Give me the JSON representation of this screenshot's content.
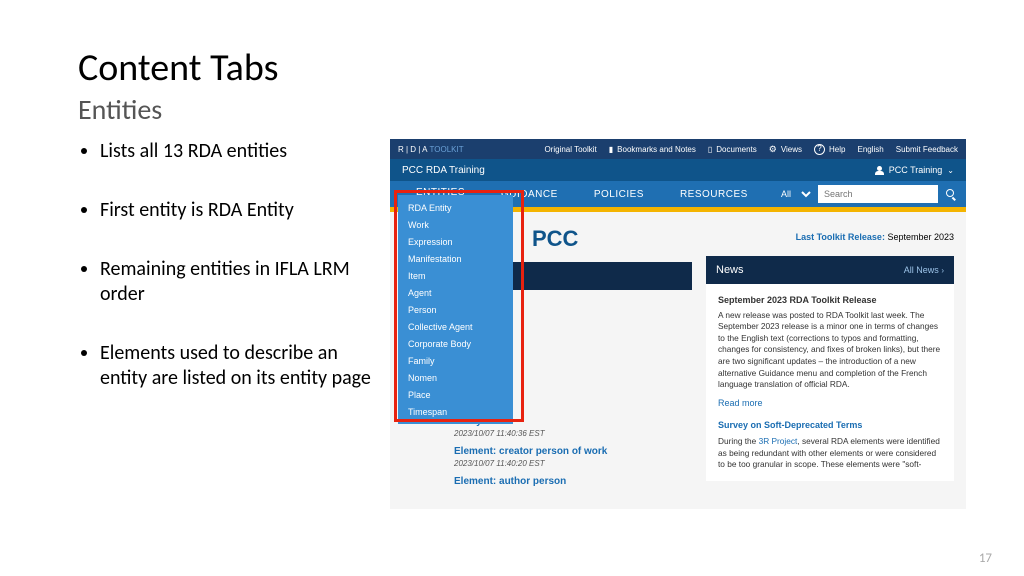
{
  "slide": {
    "title": "Content Tabs",
    "subtitle": "Entities",
    "bullets": [
      "Lists all 13 RDA entities",
      "First entity is RDA Entity",
      "Remaining entities in IFLA LRM order",
      "Elements used to describe an entity are listed on its entity page"
    ],
    "page_number": "17"
  },
  "screenshot": {
    "brand_prefix": "R | D | A",
    "brand_suffix": "TOOLKIT",
    "top_links": {
      "original": "Original Toolkit",
      "bookmarks": "Bookmarks and Notes",
      "documents": "Documents",
      "views": "Views",
      "help": "Help",
      "lang": "English",
      "feedback": "Submit Feedback"
    },
    "header2_title": "PCC RDA Training",
    "user_label": "PCC Training",
    "nav": {
      "entities": "ENTITIES",
      "guidance": "GUIDANCE",
      "policies": "POLICIES",
      "resources": "RESOURCES",
      "filter_all": "All",
      "search_placeholder": "Search"
    },
    "dropdown": [
      "RDA Entity",
      "Work",
      "Expression",
      "Manifestation",
      "Item",
      "Agent",
      "Person",
      "Collective Agent",
      "Corporate Body",
      "Family",
      "Nomen",
      "Place",
      "Timespan"
    ],
    "main_title": "PCC",
    "release_label": "Last Toolkit Release:",
    "release_value": "September 2023",
    "recent": [
      {
        "title": "Entity: Work",
        "ts": "2023/10/07 11:40:36 EST"
      },
      {
        "title": "Element: creator person of work",
        "ts": "2023/10/07 11:40:20 EST"
      },
      {
        "title": "Element: author person",
        "ts": ""
      }
    ],
    "news": {
      "heading": "News",
      "all_news": "All News",
      "item1_title": "September 2023 RDA Toolkit Release",
      "item1_body": "A new release was posted to RDA Toolkit last week. The September 2023 release is a minor one in terms of changes to the English text (corrections to typos and formatting, changes for consistency, and fixes of broken links), but there are two significant updates – the introduction of a new alternative Guidance menu and completion of the French language translation of official RDA.",
      "read_more": "Read more",
      "item2_title": "Survey on Soft-Deprecated Terms",
      "item2_body_pre": "During the ",
      "item2_link": "3R Project",
      "item2_body_post": ", several RDA elements were identified as being redundant with other elements or were considered to be too granular in scope. These elements were \"soft-"
    }
  }
}
